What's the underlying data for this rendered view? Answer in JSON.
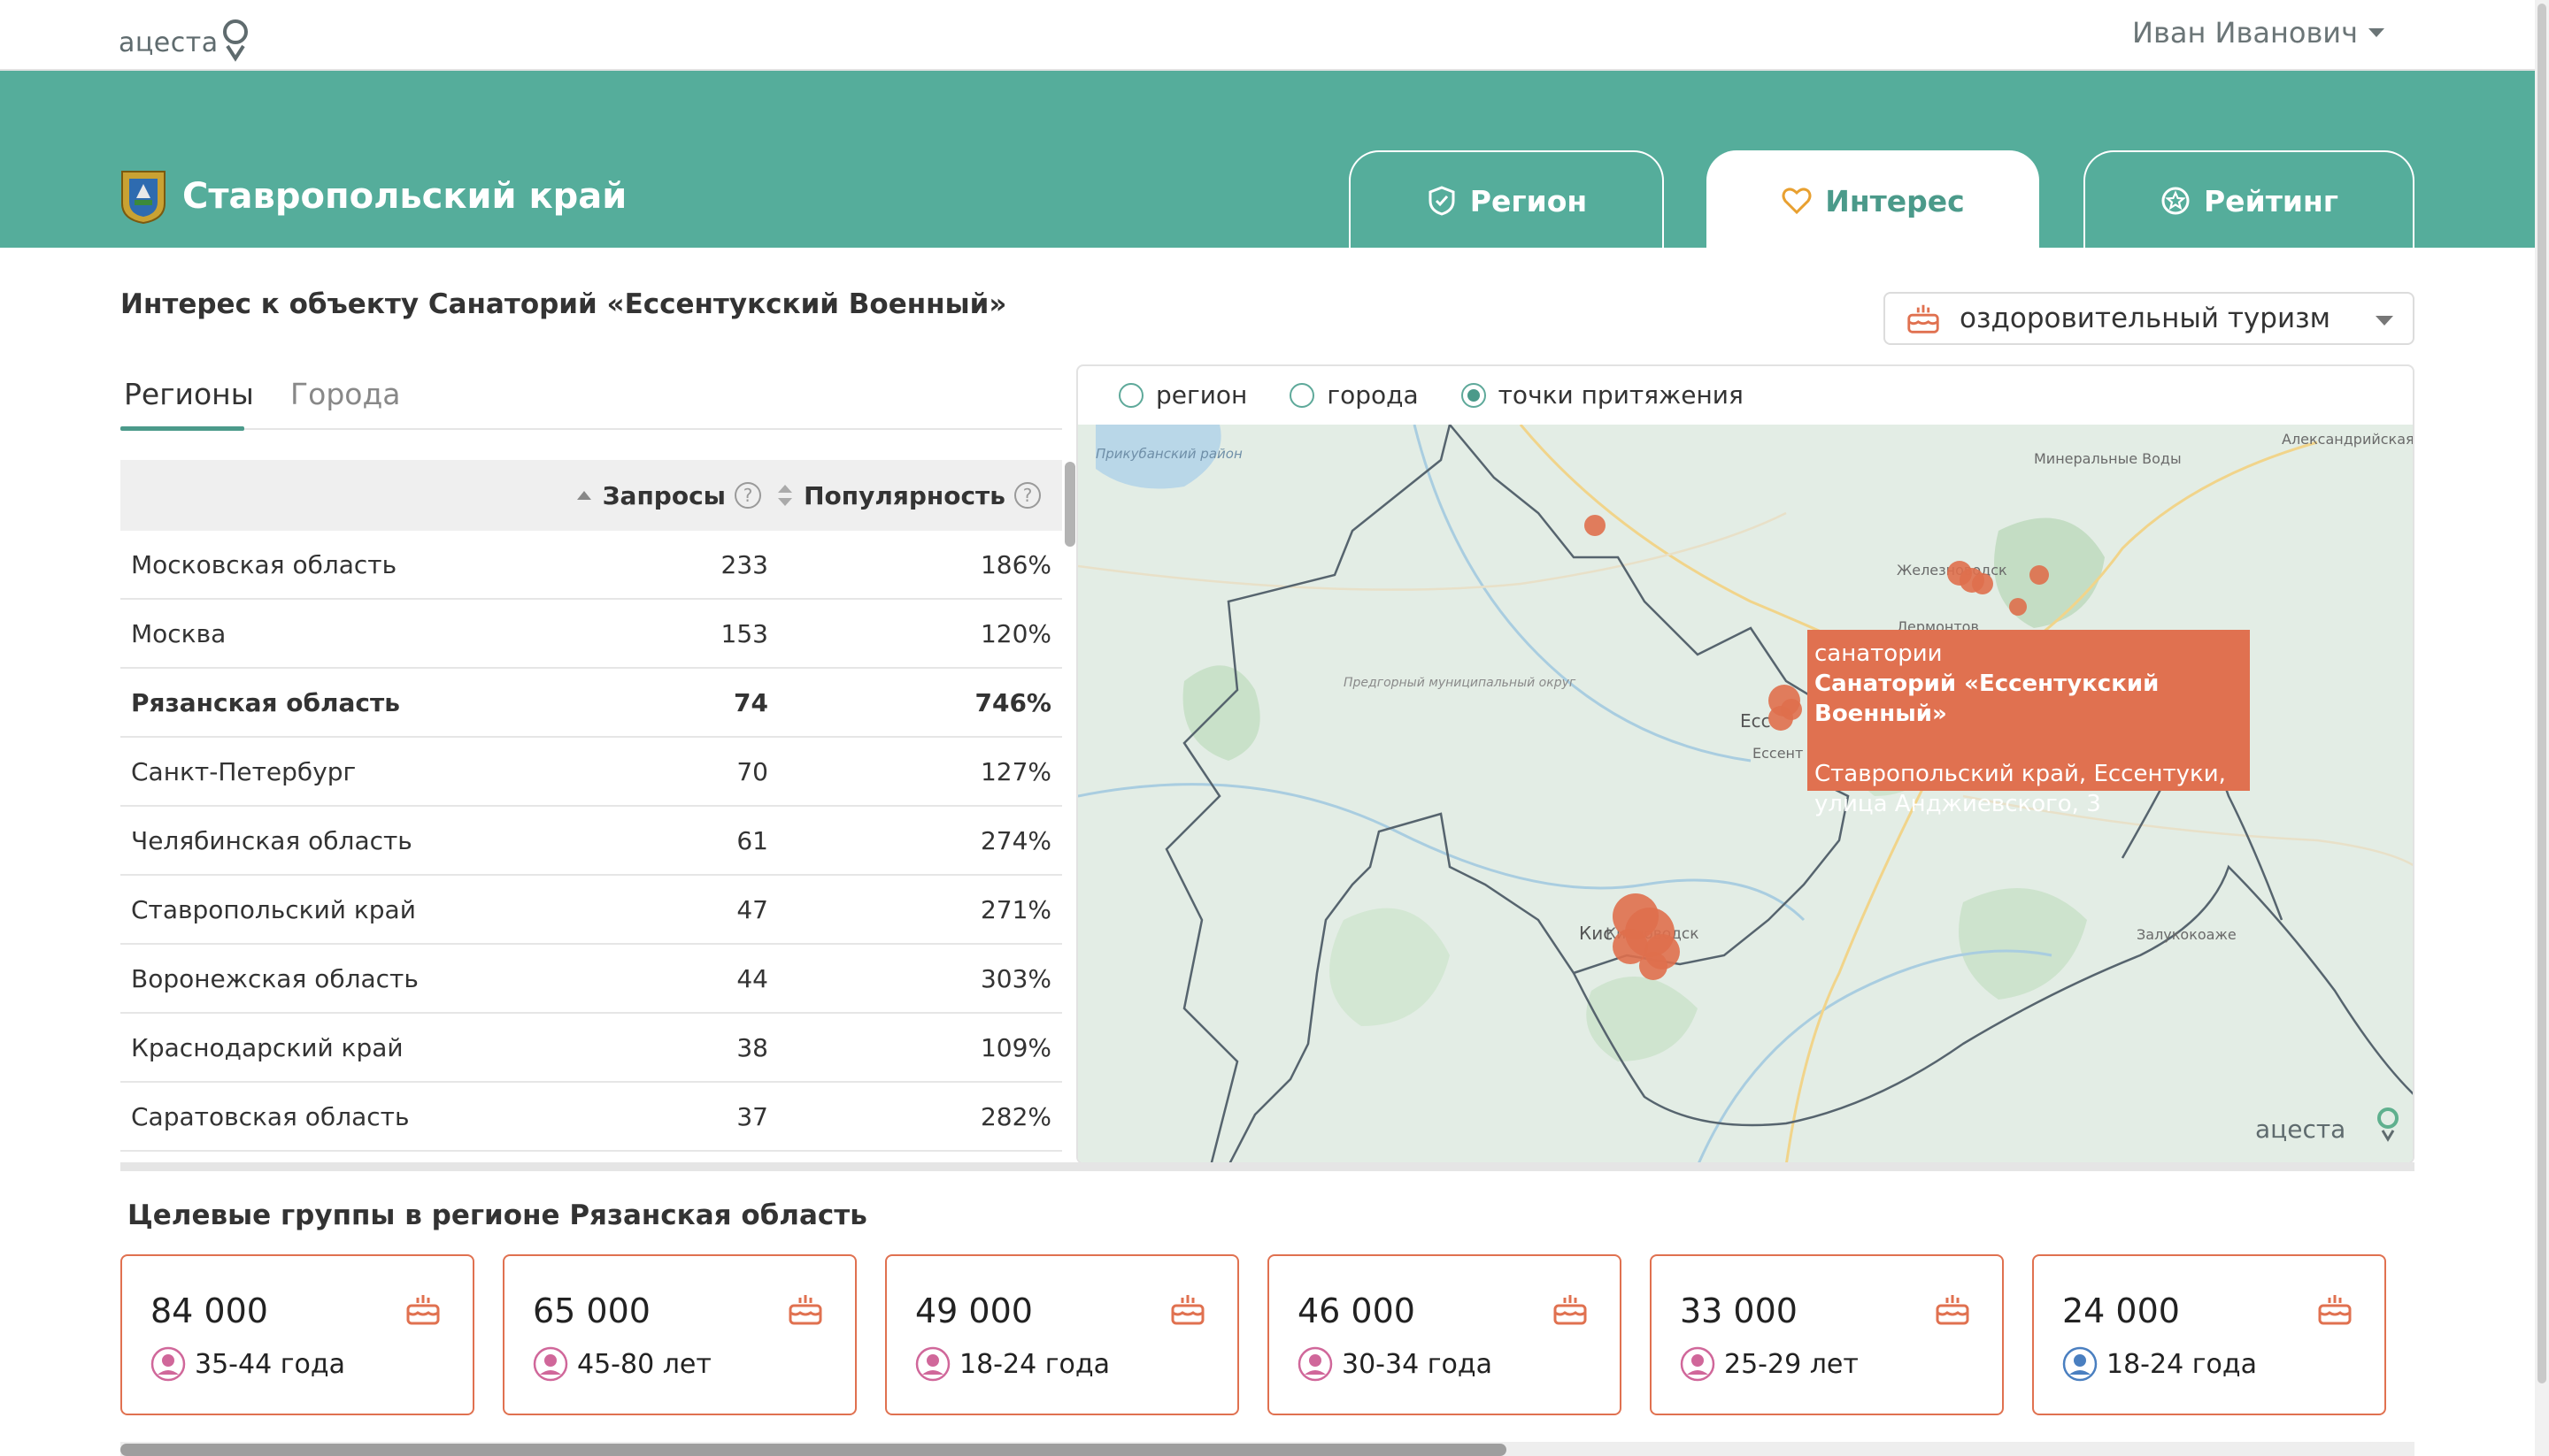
{
  "header": {
    "logo": "ацеста",
    "user_name": "Иван Иванович"
  },
  "region": {
    "title": "Ставропольский край"
  },
  "tabs": [
    {
      "label": "Регион",
      "icon": "shield-check-icon"
    },
    {
      "label": "Интерес",
      "icon": "heart-icon"
    },
    {
      "label": "Рейтинг",
      "icon": "star-badge-icon"
    }
  ],
  "section_title": "Интерес к объекту Санаторий «Ессентукский Военный»",
  "filter": {
    "selected": "оздоровительный туризм",
    "icon": "cake-icon"
  },
  "subtabs": [
    "Регионы",
    "Города"
  ],
  "table": {
    "headers": {
      "requests": "Запросы",
      "popularity": "Популярность",
      "help": "?"
    },
    "rows": [
      {
        "name": "Московская область",
        "requests": "233",
        "popularity": "186%"
      },
      {
        "name": "Москва",
        "requests": "153",
        "popularity": "120%"
      },
      {
        "name": "Рязанская область",
        "requests": "74",
        "popularity": "746%"
      },
      {
        "name": "Санкт-Петербург",
        "requests": "70",
        "popularity": "127%"
      },
      {
        "name": "Челябинская область",
        "requests": "61",
        "popularity": "274%"
      },
      {
        "name": "Ставропольский край",
        "requests": "47",
        "popularity": "271%"
      },
      {
        "name": "Воронежская область",
        "requests": "44",
        "popularity": "303%"
      },
      {
        "name": "Краснодарский край",
        "requests": "38",
        "popularity": "109%"
      },
      {
        "name": "Саратовская область",
        "requests": "37",
        "popularity": "282%"
      }
    ]
  },
  "map_modes": [
    "регион",
    "города",
    "точки притяжения"
  ],
  "map": {
    "labels": [
      "Прикубанский район",
      "Александрийская",
      "Минеральные Воды",
      "Железноводск",
      "Лермонтов",
      "Предгорный муниципальный округ",
      "Есс",
      "Ессент",
      "Кисловодск",
      "Кис",
      "Залукокоаже",
      "ацеста"
    ],
    "tooltip": {
      "category": "санатории",
      "name": "Санаторий «Ессентукский Военный»",
      "address": "Ставропольский край, Ессентуки, улица Анджиевского, 3"
    }
  },
  "groups": {
    "title": "Целевые группы в регионе Рязанская область",
    "cards": [
      {
        "count": "84 000",
        "age": "35-44 года",
        "gender": "female"
      },
      {
        "count": "65 000",
        "age": "45-80 лет",
        "gender": "female"
      },
      {
        "count": "49 000",
        "age": "18-24 года",
        "gender": "female"
      },
      {
        "count": "46 000",
        "age": "30-34 года",
        "gender": "female"
      },
      {
        "count": "33 000",
        "age": "25-29 лет",
        "gender": "female"
      },
      {
        "count": "24 000",
        "age": "18-24 года",
        "gender": "male"
      }
    ]
  },
  "colors": {
    "teal": "#55ad9b",
    "accent": "#e07150",
    "active_tab_text": "#4b9a8a"
  }
}
